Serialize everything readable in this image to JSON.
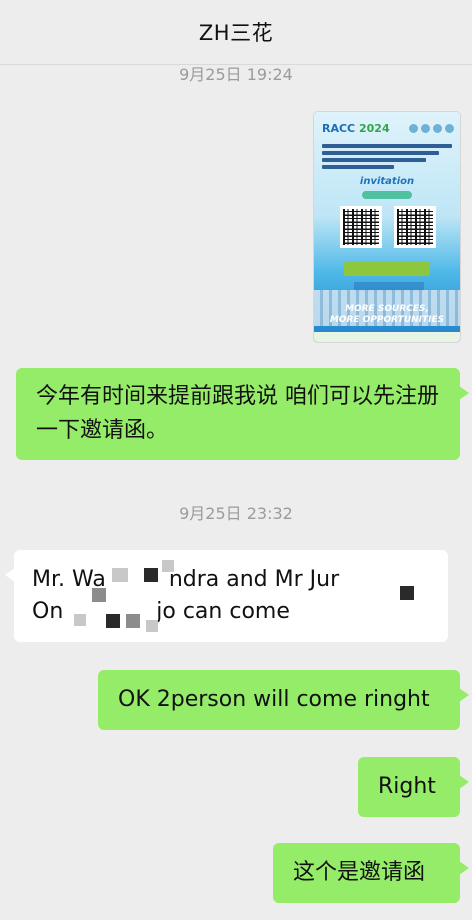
{
  "header": {
    "title": "ZH三花"
  },
  "messages": [
    {
      "time": "9月25日 19:24"
    },
    {
      "image": {
        "brand": "RACC",
        "year": "2024",
        "label": "invitation",
        "tagline_1": "MORE SOURCES,",
        "tagline_2": "MORE OPPORTUNITIES"
      }
    },
    {
      "text": "今年有时间来提前跟我说 咱们可以先注册一下邀请函。"
    },
    {
      "time": "9月25日 23:32"
    },
    {
      "line1": "Mr. Wa",
      "line1b": "ndra and Mr Jur",
      "line2": "On",
      "line2b": "jo can come"
    },
    {
      "text": "OK 2person will come ringht"
    },
    {
      "text": "Right"
    },
    {
      "text": "这个是邀请函"
    }
  ],
  "colors": {
    "outgoing": "#95ec69",
    "incoming": "#ffffff",
    "background": "#ededed"
  }
}
